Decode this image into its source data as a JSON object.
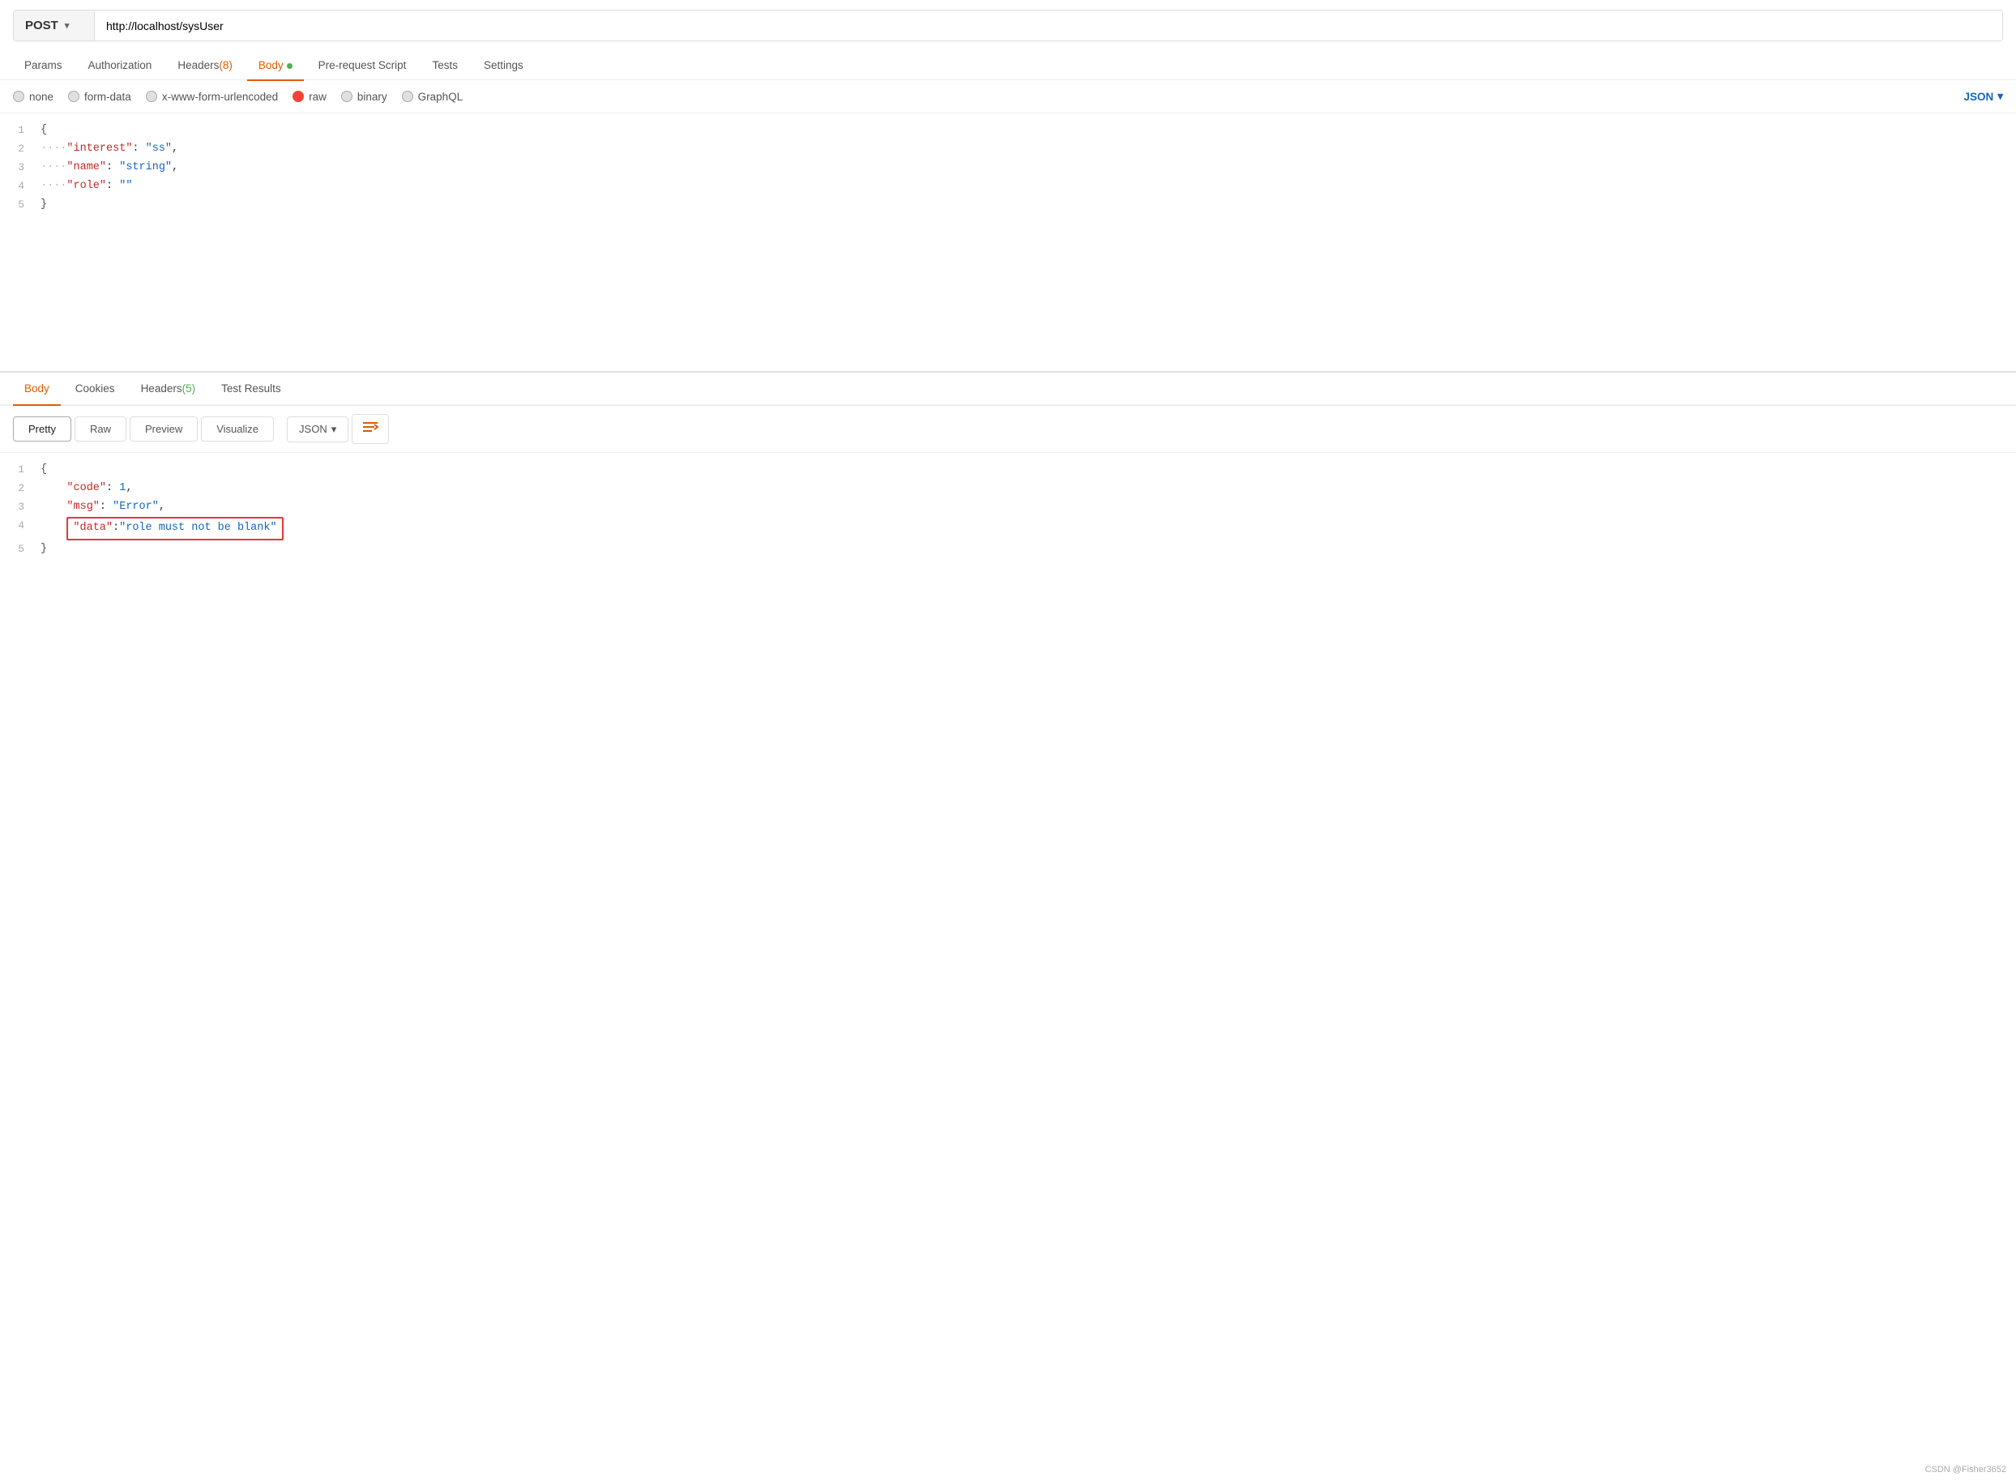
{
  "url_bar": {
    "method": "POST",
    "url": "http://localhost/sysUser"
  },
  "tabs": [
    {
      "label": "Params",
      "active": false
    },
    {
      "label": "Authorization",
      "active": false
    },
    {
      "label": "Headers",
      "badge": "(8)",
      "active": false
    },
    {
      "label": "Body",
      "dot": true,
      "active": true
    },
    {
      "label": "Pre-request Script",
      "active": false
    },
    {
      "label": "Tests",
      "active": false
    },
    {
      "label": "Settings",
      "active": false
    }
  ],
  "body_types": [
    {
      "label": "none",
      "active": false
    },
    {
      "label": "form-data",
      "active": false
    },
    {
      "label": "x-www-form-urlencoded",
      "active": false
    },
    {
      "label": "raw",
      "active": true
    },
    {
      "label": "binary",
      "active": false
    },
    {
      "label": "GraphQL",
      "active": false
    }
  ],
  "json_dropdown": "JSON",
  "request_body": [
    {
      "line": 1,
      "content": "{"
    },
    {
      "line": 2,
      "content": "    \"interest\": \"ss\","
    },
    {
      "line": 3,
      "content": "    \"name\": \"string\","
    },
    {
      "line": 4,
      "content": "    \"role\": \"\""
    },
    {
      "line": 5,
      "content": "}"
    }
  ],
  "response_tabs": [
    {
      "label": "Body",
      "active": true
    },
    {
      "label": "Cookies",
      "active": false
    },
    {
      "label": "Headers",
      "badge": "(5)",
      "active": false
    },
    {
      "label": "Test Results",
      "active": false
    }
  ],
  "resp_buttons": [
    "Pretty",
    "Raw",
    "Preview",
    "Visualize"
  ],
  "resp_format": "JSON",
  "response_body": [
    {
      "line": 1,
      "content": "{"
    },
    {
      "line": 2,
      "content": "    \"code\": 1,"
    },
    {
      "line": 3,
      "content": "    \"msg\": \"Error\","
    },
    {
      "line": 4,
      "content": "    \"data\": \"role must not be blank\"",
      "highlight": true
    },
    {
      "line": 5,
      "content": "}"
    }
  ],
  "watermark": "CSDN @Fisher3652"
}
